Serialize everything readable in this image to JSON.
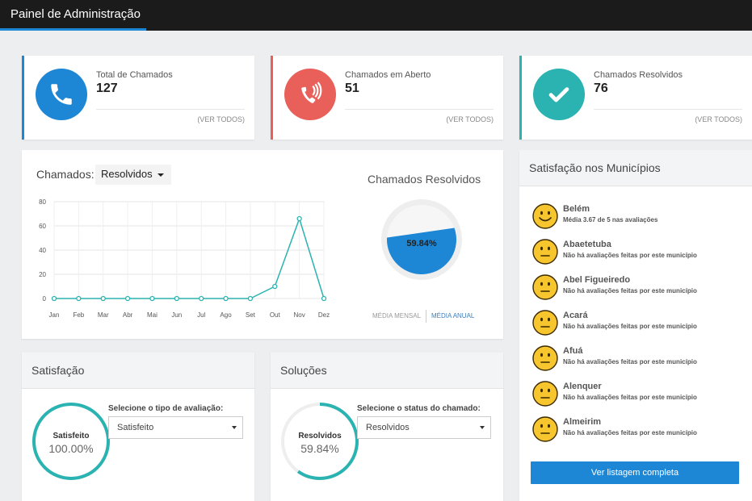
{
  "app": {
    "title": "Painel de Administração"
  },
  "stats": [
    {
      "label": "Total de Chamados",
      "value": "127",
      "link": "(VER TODOS)",
      "color": "#1d87d6",
      "icon": "phone-icon"
    },
    {
      "label": "Chamados em Aberto",
      "value": "51",
      "link": "(VER TODOS)",
      "color": "#e9605a",
      "icon": "phone-ringing-icon"
    },
    {
      "label": "Chamados Resolvidos",
      "value": "76",
      "link": "(VER TODOS)",
      "color": "#2ab3b1",
      "icon": "checkmark-icon"
    }
  ],
  "chart_panel": {
    "label": "Chamados:",
    "dropdown_value": "Resolvidos",
    "gauge_title": "Chamados Resolvidos",
    "gauge_value": "59.84%",
    "gauge_fraction": 0.5984,
    "tab_monthly": "MÉDIA MENSAL",
    "tab_annual": "MÉDIA ANUAL"
  },
  "chart_data": {
    "type": "line",
    "categories": [
      "Jan",
      "Feb",
      "Mar",
      "Abr",
      "Mai",
      "Jun",
      "Jul",
      "Ago",
      "Set",
      "Out",
      "Nov",
      "Dez"
    ],
    "values": [
      0,
      0,
      0,
      0,
      0,
      0,
      0,
      0,
      0,
      10,
      66,
      0
    ],
    "yticks": [
      0,
      20,
      40,
      60,
      80
    ],
    "ylim": [
      0,
      80
    ],
    "grid": true,
    "color": "#2ab3b1"
  },
  "satisfacao": {
    "title": "Satisfação",
    "ring_name": "Satisfeito",
    "ring_value": "100.00%",
    "ring_fraction": 1.0,
    "select_label": "Selecione o tipo de avaliação:",
    "select_value": "Satisfeito"
  },
  "solucoes": {
    "title": "Soluções",
    "ring_name": "Resolvidos",
    "ring_value": "59.84%",
    "ring_fraction": 0.5984,
    "select_label": "Selecione o status do chamado:",
    "select_value": "Resolvidos"
  },
  "municipios": {
    "title": "Satisfação nos Municípios",
    "items": [
      {
        "name": "Belém",
        "desc": "Média 3.67 de 5 nas avaliações",
        "mood": "smile"
      },
      {
        "name": "Abaetetuba",
        "desc": "Não há avaliações feitas por este município",
        "mood": "neutral"
      },
      {
        "name": "Abel Figueiredo",
        "desc": "Não há avaliações feitas por este município",
        "mood": "neutral"
      },
      {
        "name": "Acará",
        "desc": "Não há avaliações feitas por este município",
        "mood": "neutral"
      },
      {
        "name": "Afuá",
        "desc": "Não há avaliações feitas por este município",
        "mood": "neutral"
      },
      {
        "name": "Alenquer",
        "desc": "Não há avaliações feitas por este município",
        "mood": "neutral"
      },
      {
        "name": "Almeirim",
        "desc": "Não há avaliações feitas por este município",
        "mood": "neutral"
      }
    ],
    "button": "Ver listagem completa"
  }
}
